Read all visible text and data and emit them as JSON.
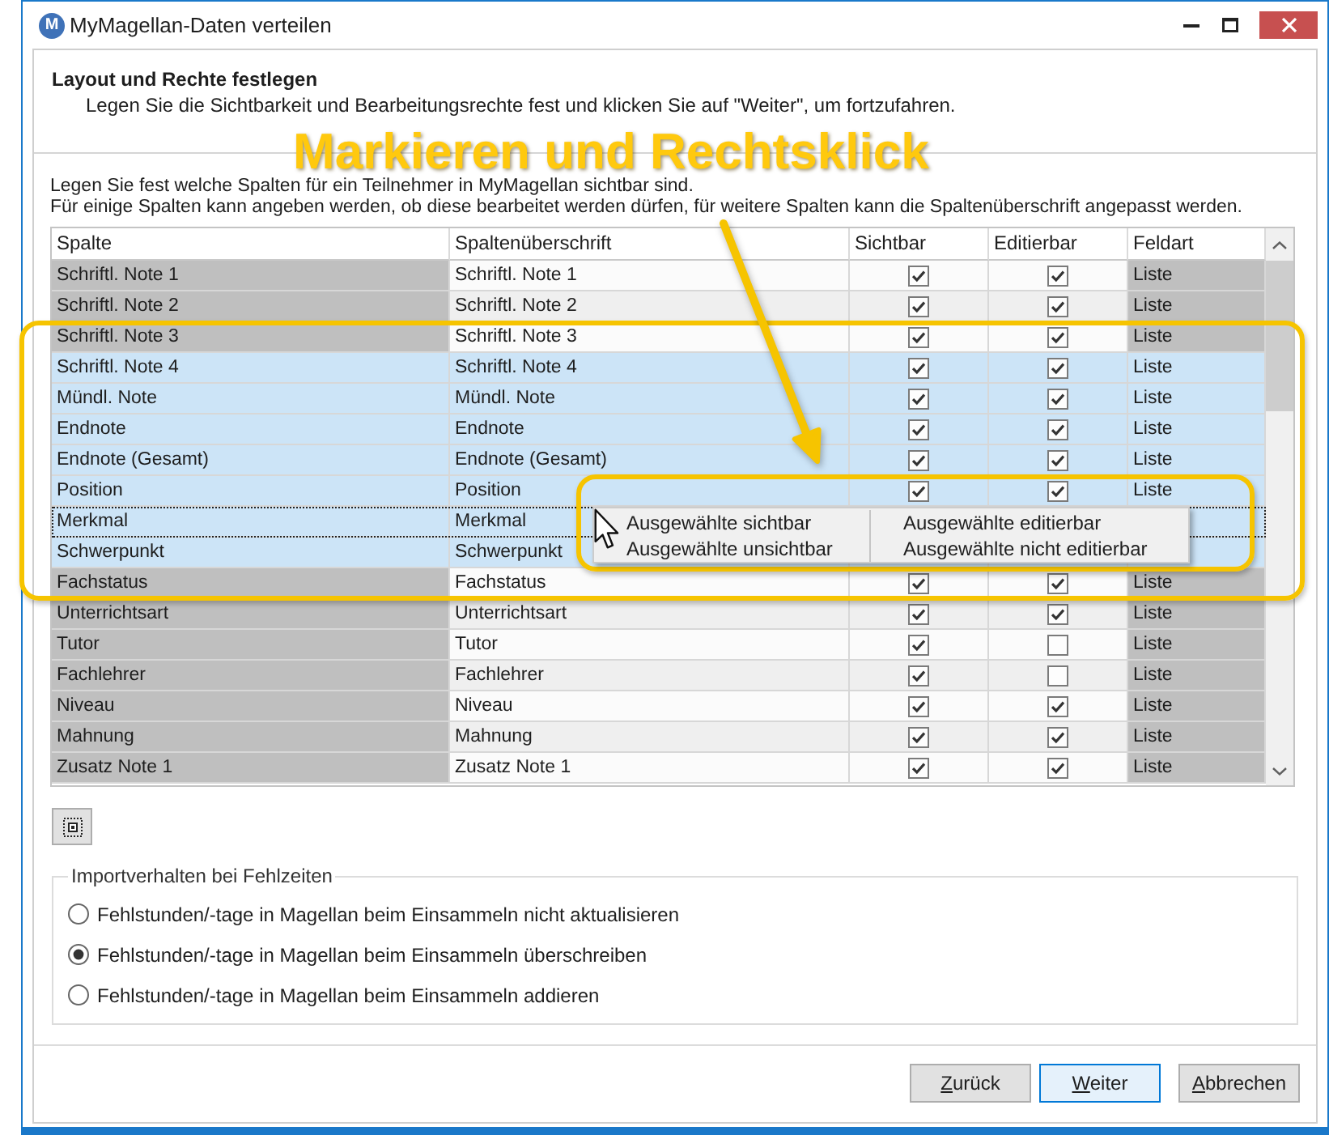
{
  "window": {
    "title": "MyMagellan-Daten verteilen",
    "icon_letter": "M"
  },
  "header": {
    "title": "Layout und Rechte festlegen",
    "subtitle": "Legen Sie die Sichtbarkeit und Bearbeitungsrechte fest und klicken Sie auf \"Weiter\", um fortzufahren."
  },
  "annotation": {
    "text": "Markieren und Rechtsklick"
  },
  "instructions": [
    "Legen Sie fest welche Spalten für ein Teilnehmer in MyMagellan sichtbar sind.",
    "Für einige Spalten kann angeben werden, ob diese bearbeitet werden dürfen, für weitere Spalten kann die Spaltenüberschrift angepasst werden."
  ],
  "table": {
    "columns": [
      "Spalte",
      "Spaltenüberschrift",
      "Sichtbar",
      "Editierbar",
      "Feldart"
    ],
    "rows": [
      {
        "column": "Schriftl. Note 1",
        "heading": "Schriftl. Note 1",
        "visible": true,
        "editable": true,
        "field_type": "Liste",
        "selected": false,
        "focused": false
      },
      {
        "column": "Schriftl. Note 2",
        "heading": "Schriftl. Note 2",
        "visible": true,
        "editable": true,
        "field_type": "Liste",
        "selected": false,
        "focused": false
      },
      {
        "column": "Schriftl. Note 3",
        "heading": "Schriftl. Note 3",
        "visible": true,
        "editable": true,
        "field_type": "Liste",
        "selected": false,
        "focused": false
      },
      {
        "column": "Schriftl. Note 4",
        "heading": "Schriftl. Note 4",
        "visible": true,
        "editable": true,
        "field_type": "Liste",
        "selected": true,
        "focused": false
      },
      {
        "column": "Mündl. Note",
        "heading": "Mündl. Note",
        "visible": true,
        "editable": true,
        "field_type": "Liste",
        "selected": true,
        "focused": false
      },
      {
        "column": "Endnote",
        "heading": "Endnote",
        "visible": true,
        "editable": true,
        "field_type": "Liste",
        "selected": true,
        "focused": false
      },
      {
        "column": "Endnote (Gesamt)",
        "heading": "Endnote (Gesamt)",
        "visible": true,
        "editable": true,
        "field_type": "Liste",
        "selected": true,
        "focused": false
      },
      {
        "column": "Position",
        "heading": "Position",
        "visible": true,
        "editable": true,
        "field_type": "Liste",
        "selected": true,
        "focused": false
      },
      {
        "column": "Merkmal",
        "heading": "Merkmal",
        "selected": true,
        "focused": true
      },
      {
        "column": "Schwerpunkt",
        "heading": "Schwerpunkt",
        "selected": true,
        "focused": false
      },
      {
        "column": "Fachstatus",
        "heading": "Fachstatus",
        "visible": true,
        "editable": true,
        "field_type": "Liste",
        "selected": false,
        "focused": false
      },
      {
        "column": "Unterrichtsart",
        "heading": "Unterrichtsart",
        "visible": true,
        "editable": true,
        "field_type": "Liste",
        "selected": false,
        "focused": false
      },
      {
        "column": "Tutor",
        "heading": "Tutor",
        "visible": true,
        "editable": false,
        "field_type": "Liste",
        "selected": false,
        "focused": false
      },
      {
        "column": "Fachlehrer",
        "heading": "Fachlehrer",
        "visible": true,
        "editable": false,
        "field_type": "Liste",
        "selected": false,
        "focused": false
      },
      {
        "column": "Niveau",
        "heading": "Niveau",
        "visible": true,
        "editable": true,
        "field_type": "Liste",
        "selected": false,
        "focused": false
      },
      {
        "column": "Mahnung",
        "heading": "Mahnung",
        "visible": true,
        "editable": true,
        "field_type": "Liste",
        "selected": false,
        "focused": false
      },
      {
        "column": "Zusatz Note 1",
        "heading": "Zusatz Note 1",
        "visible": true,
        "editable": true,
        "field_type": "Liste",
        "selected": false,
        "focused": false
      }
    ]
  },
  "context_menu": {
    "columns": [
      {
        "items": [
          "Ausgewählte sichtbar",
          "Ausgewählte unsichtbar"
        ]
      },
      {
        "items": [
          "Ausgewählte editierbar",
          "Ausgewählte nicht editierbar"
        ]
      }
    ]
  },
  "import_group": {
    "title": "Importverhalten bei Fehlzeiten",
    "options": [
      {
        "label": "Fehlstunden/-tage in Magellan beim Einsammeln nicht aktualisieren",
        "selected": false
      },
      {
        "label": "Fehlstunden/-tage in Magellan beim Einsammeln überschreiben",
        "selected": true
      },
      {
        "label": "Fehlstunden/-tage in Magellan beim Einsammeln addieren",
        "selected": false
      }
    ]
  },
  "buttons": [
    {
      "label": "Zurück",
      "default": false
    },
    {
      "label": "Weiter",
      "default": true
    },
    {
      "label": "Abbrechen",
      "default": false
    }
  ]
}
